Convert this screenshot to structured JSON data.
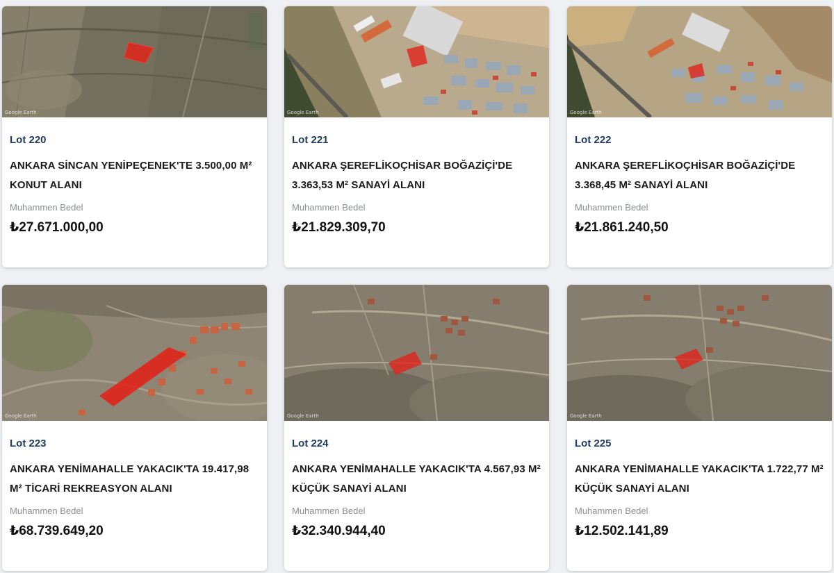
{
  "price_label": "Muhammen Bedel",
  "watermark": "Google Earth",
  "lots": [
    {
      "lot": "Lot 220",
      "title": "ANKARA SİNCAN YENİPEÇENEK'TE 3.500,00 M² KONUT ALANI",
      "price": "₺27.671.000,00"
    },
    {
      "lot": "Lot 221",
      "title": "ANKARA ŞEREFLİKOÇHİSAR BOĞAZİÇİ'DE 3.363,53 M² SANAYİ ALANI",
      "price": "₺21.829.309,70"
    },
    {
      "lot": "Lot 222",
      "title": "ANKARA ŞEREFLİKOÇHİSAR BOĞAZİÇİ'DE 3.368,45 M² SANAYİ ALANI",
      "price": "₺21.861.240,50"
    },
    {
      "lot": "Lot 223",
      "title": "ANKARA YENİMAHALLE YAKACIK'TA 19.417,98 M² TİCARİ REKREASYON ALANI",
      "price": "₺68.739.649,20"
    },
    {
      "lot": "Lot 224",
      "title": "ANKARA YENİMAHALLE YAKACIK'TA 4.567,93 M² KÜÇÜK SANAYİ ALANI",
      "price": "₺32.340.944,40"
    },
    {
      "lot": "Lot 225",
      "title": "ANKARA YENİMAHALLE YAKACIK'TA 1.722,77 M² KÜÇÜK SANAYİ ALANI",
      "price": "₺12.502.141,89"
    }
  ],
  "colors": {
    "lot_number": "#1e3a5f",
    "parcel_highlight": "#e0241b",
    "price_label": "#8a8f96"
  }
}
